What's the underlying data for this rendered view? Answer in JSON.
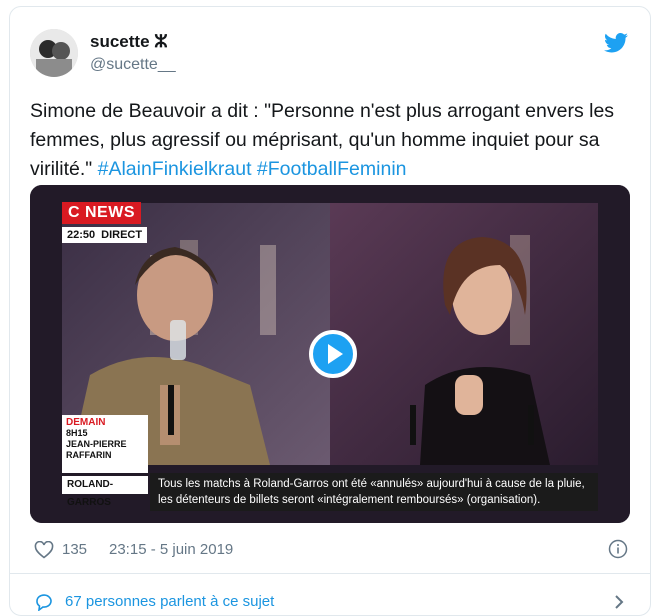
{
  "author": {
    "display_name": "sucette ⵣ",
    "handle": "@sucette__"
  },
  "tweet": {
    "text": "Simone de Beauvoir a dit : \"Personne n'est plus arrogant envers les femmes, plus agressif ou méprisant, qu'un homme inquiet pour sa virilité.\" ",
    "hashtags": [
      "#AlainFinkielkraut",
      "#FootballFeminin"
    ]
  },
  "media": {
    "channel": "C NEWS",
    "time": "22:50",
    "live_label": "DIRECT",
    "promo": {
      "demain": "DEMAIN",
      "slot": "8H15",
      "guest_first": "JEAN-PIERRE",
      "guest_last": "RAFFARIN"
    },
    "ticker_label": "ROLAND-GARROS",
    "ticker_text": "Tous les matchs à Roland-Garros ont été «annulés» aujourd'hui à cause de la pluie, les détenteurs de billets seront «intégralement remboursés» (organisation)."
  },
  "footer": {
    "likes": "135",
    "timestamp": "23:15 - 5 juin 2019",
    "talk_link": "67 personnes parlent à ce sujet"
  },
  "colors": {
    "accent": "#1b95e0",
    "play_button": "#1da1f2",
    "cnews_red": "#d91a22",
    "muted_text": "#657786"
  },
  "icons": [
    "avatar",
    "twitter-logo-icon",
    "play-icon",
    "heart-icon",
    "info-icon",
    "comment-icon",
    "chevron-right-icon"
  ]
}
